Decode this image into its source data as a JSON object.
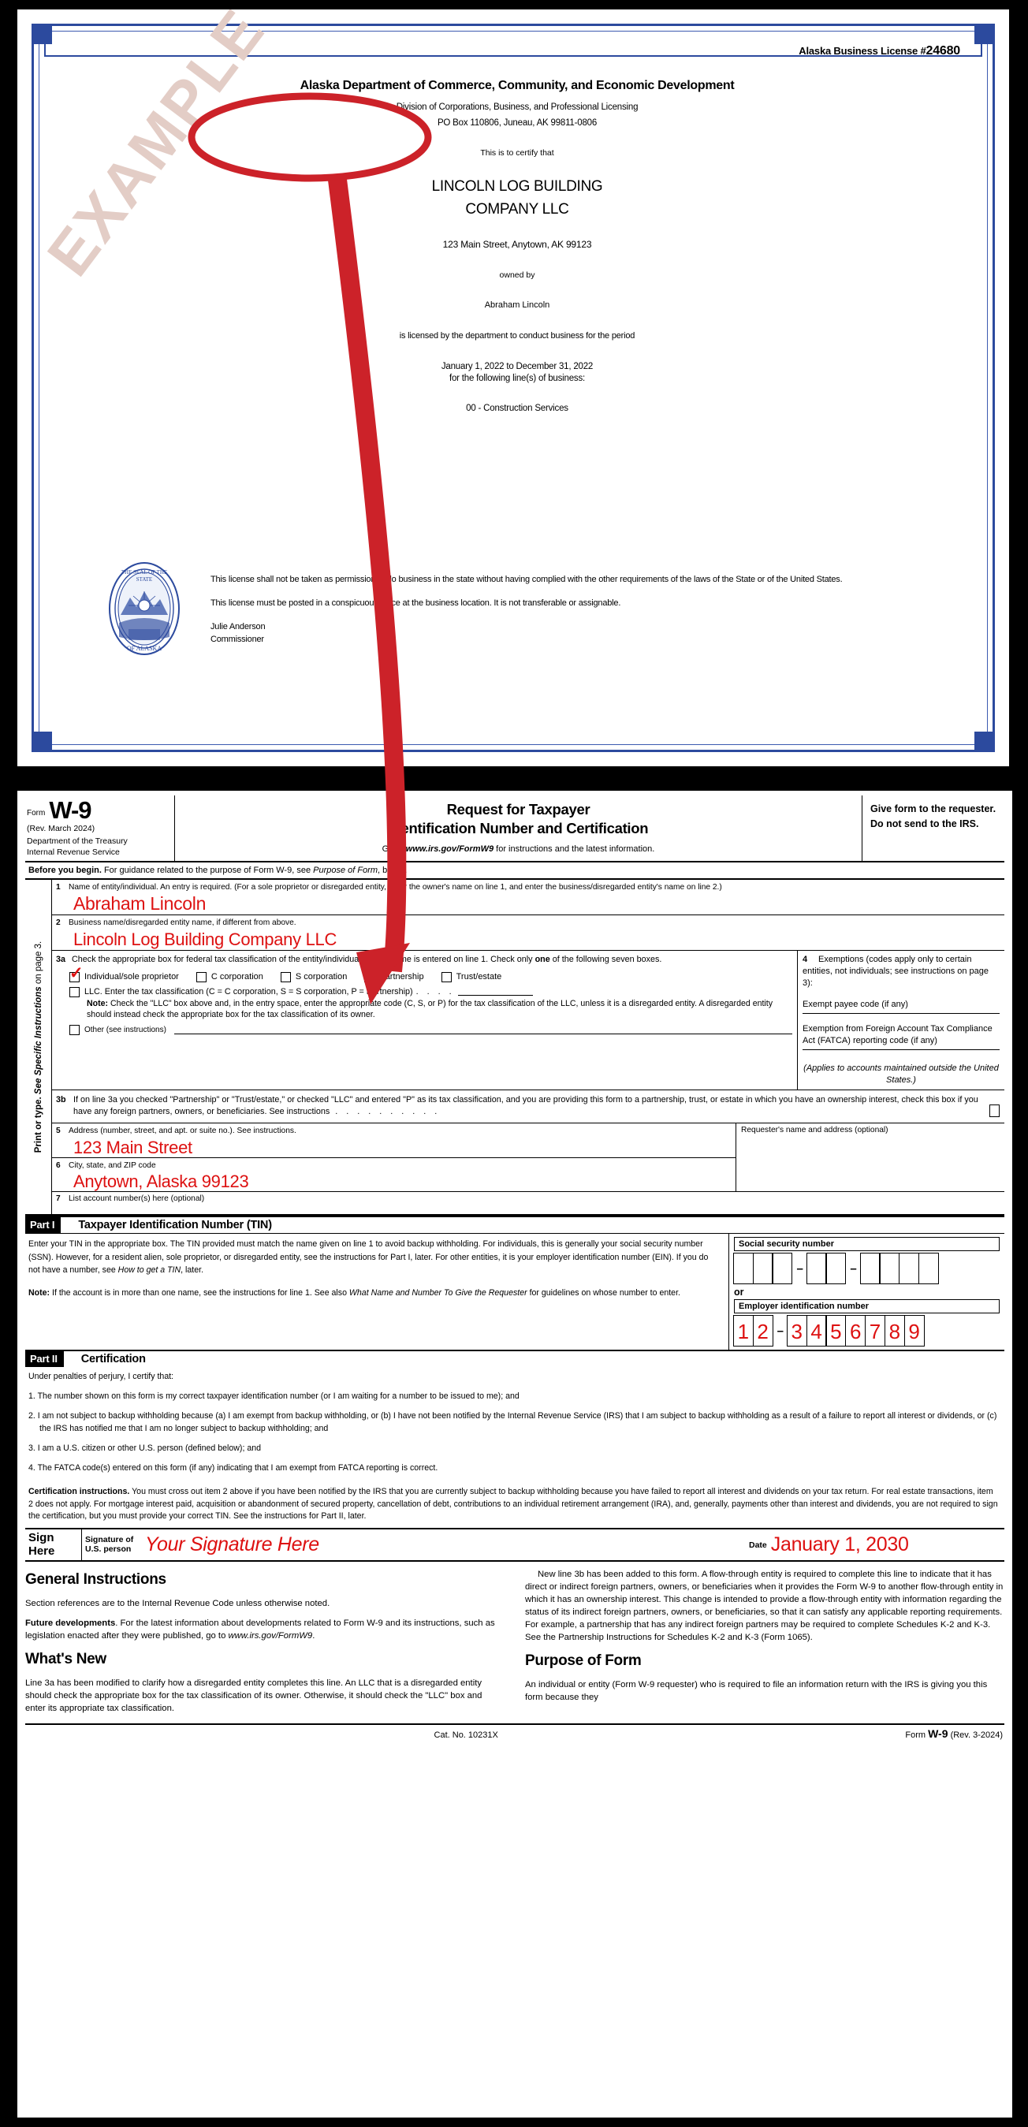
{
  "license": {
    "license_number_label": "Alaska Business License #",
    "license_number": "24680",
    "department": "Alaska Department of Commerce, Community, and Economic Development",
    "division": "Division of Corporations, Business, and Professional Licensing",
    "po_box": "PO Box 110806, Juneau, AK 99811-0806",
    "certify_line": "This is to certify that",
    "business_name_line1": "LINCOLN LOG BUILDING",
    "business_name_line2": "COMPANY LLC",
    "address": "123 Main Street, Anytown, AK 99123",
    "owned_by_label": "owned by",
    "owner_name": "Abraham Lincoln",
    "licensed_line": "is licensed by the department to conduct business for the period",
    "period": "January 1, 2022 to December 31, 2022",
    "lines_of_business_label": "for the following line(s) of business:",
    "line_of_business": "00 - Construction Services",
    "disclaimer_1": "This license shall not be taken as permission to do business in the state without having complied with the other requirements of the laws of the State or of the United States.",
    "disclaimer_2": "This license must be posted in a conspicuous place at the business location. It is not transferable or assignable.",
    "commissioner_name": "Julie Anderson",
    "commissioner_title": "Commissioner",
    "watermark": "EXAMPLE",
    "seal_text_top": "THE SEAL OF THE STATE",
    "seal_text_bottom": "OF ALASKA"
  },
  "w9": {
    "form_word": "Form",
    "form_number": "W-9",
    "revision": "(Rev. March 2024)",
    "department_line1": "Department of the Treasury",
    "department_line2": "Internal Revenue Service",
    "title_line1": "Request for Taxpayer",
    "title_line2": "Identification Number and Certification",
    "goto_prefix": "Go to ",
    "goto_url": "www.irs.gov/FormW9",
    "goto_suffix": " for instructions and the latest information.",
    "give_form_note": "Give form to the requester. Do not send to the IRS.",
    "before_you_begin_bold": "Before you begin.",
    "before_you_begin_text": " For guidance related to the purpose of Form W-9, see ",
    "before_you_begin_italic": "Purpose of Form",
    "before_you_begin_tail": ", below.",
    "side_rail_bold": "Print or type.",
    "side_rail_italic": "See Specific Instructions",
    "side_rail_tail": " on page 3.",
    "line1_num": "1",
    "line1_hint": "Name of entity/individual. An entry is required. (For a sole proprietor or disregarded entity, enter the owner's name on line 1, and enter the business/disregarded entity's name on line 2.)",
    "line1_value": "Abraham Lincoln",
    "line2_num": "2",
    "line2_hint": "Business name/disregarded entity name, if different from above.",
    "line2_value": "Lincoln Log Building Company LLC",
    "line3a_num": "3a",
    "line3a_text_a": "Check the appropriate box for federal tax classification of the entity/individual whose name is entered on line 1. Check only ",
    "line3a_text_bold": "one",
    "line3a_text_b": " of the following seven boxes.",
    "checkbox_individual": "Individual/sole proprietor",
    "checkbox_ccorp": "C corporation",
    "checkbox_scorp": "S corporation",
    "checkbox_partnership": "Partnership",
    "checkbox_trust": "Trust/estate",
    "checked_box": "Individual/sole proprietor",
    "check_mark": "✓",
    "llc_text": "LLC. Enter the tax classification (C = C corporation, S = S corporation, P = Partnership)",
    "llc_note_bold": "Note:",
    "llc_note": " Check the \"LLC\" box above and, in the entry space, enter the appropriate code (C, S, or P) for the tax classification of the LLC, unless it is a disregarded entity. A disregarded entity should instead check the appropriate box for the tax classification of its owner.",
    "other_label": "Other (see instructions)",
    "line3b_num": "3b",
    "line3b_text": "If on line 3a you checked \"Partnership\" or \"Trust/estate,\" or checked \"LLC\" and entered \"P\" as its tax classification, and you are providing this form to a partnership, trust, or estate in which you have an ownership interest, check this box if you have any foreign partners, owners, or beneficiaries. See instructions",
    "line4_num": "4",
    "line4_text": "Exemptions (codes apply only to certain entities, not individuals; see instructions on page 3):",
    "exempt_payee_label": "Exempt payee code (if any)",
    "exempt_payee_value": "",
    "fatca_label": "Exemption from Foreign Account Tax Compliance Act (FATCA) reporting code (if any)",
    "fatca_value": "",
    "applies_note": "(Applies to accounts maintained outside the United States.)",
    "line5_num": "5",
    "line5_hint": "Address (number, street, and apt. or suite no.). See instructions.",
    "line5_value": "123 Main Street",
    "line6_num": "6",
    "line6_hint": "City, state, and ZIP code",
    "line6_value": "Anytown, Alaska 99123",
    "line7_num": "7",
    "line7_hint": "List account number(s) here (optional)",
    "requester_label": "Requester's name and address (optional)",
    "part1_chip": "Part I",
    "part1_title": "Taxpayer Identification Number (TIN)",
    "part1_p1": "Enter your TIN in the appropriate box. The TIN provided must match the name given on line 1 to avoid backup withholding. For individuals, this is generally your social security number (SSN). However, for a resident alien, sole proprietor, or disregarded entity, see the instructions for Part I, later. For other entities, it is your employer identification number (EIN). If you do not have a number, see ",
    "part1_p1_italic": "How to get a TIN",
    "part1_p1_tail": ", later.",
    "part1_note_bold": "Note:",
    "part1_note": " If the account is in more than one name, see the instructions for line 1. See also ",
    "part1_note_italic": "What Name and Number To Give the Requester",
    "part1_note_tail": " for guidelines on whose number to enter.",
    "ssn_label": "Social security number",
    "ssn_digits": [
      "",
      "",
      "",
      "",
      "",
      "",
      "",
      "",
      ""
    ],
    "or_word": "or",
    "ein_label": "Employer identification number",
    "ein_digits": [
      "1",
      "2",
      "3",
      "4",
      "5",
      "6",
      "7",
      "8",
      "9"
    ],
    "part2_chip": "Part II",
    "part2_title": "Certification",
    "cert_intro": "Under penalties of perjury, I certify that:",
    "cert_items": [
      "1. The number shown on this form is my correct taxpayer identification number (or I am waiting for a number to be issued to me); and",
      "2. I am not subject to backup withholding because (a) I am exempt from backup withholding, or (b) I have not been notified by the Internal Revenue Service (IRS) that I am subject to backup withholding as a result of a failure to report all interest or dividends, or (c) the IRS has notified me that I am no longer subject to backup withholding; and",
      "3. I am a U.S. citizen or other U.S. person (defined below); and",
      "4. The FATCA code(s) entered on this form (if any) indicating that I am exempt from FATCA reporting is correct."
    ],
    "cert_instructions_bold": "Certification instructions.",
    "cert_instructions": " You must cross out item 2 above if you have been notified by the IRS that you are currently subject to backup withholding because you have failed to report all interest and dividends on your tax return. For real estate transactions, item 2 does not apply. For mortgage interest paid, acquisition or abandonment of secured property, cancellation of debt, contributions to an individual retirement arrangement (IRA), and, generally, payments other than interest and dividends, you are not required to sign the certification, but you must provide your correct TIN. See the instructions for Part II, later.",
    "sign_here_label": "Sign Here",
    "signature_of_label": "Signature of U.S. person",
    "signature_value": "Your Signature Here",
    "date_label": "Date",
    "date_value": "January 1, 2030",
    "general_instructions_heading": "General Instructions",
    "general_instructions_p1": "Section references are to the Internal Revenue Code unless otherwise noted.",
    "future_dev_bold": "Future developments",
    "future_dev_text": ". For the latest information about developments related to Form W-9 and its instructions, such as legislation enacted after they were published, go to ",
    "future_dev_url": "www.irs.gov/FormW9",
    "future_dev_tail": ".",
    "whats_new_heading": "What's New",
    "whats_new_p1": "Line 3a has been modified to clarify how a disregarded entity completes this line. An LLC that is a disregarded entity should check the appropriate box for the tax classification of its owner. Otherwise, it should check the \"LLC\" box and enter its appropriate tax classification.",
    "whats_new_p2": "New line 3b has been added to this form. A flow-through entity is required to complete this line to indicate that it has direct or indirect foreign partners, owners, or beneficiaries when it provides the Form W-9 to another flow-through entity in which it has an ownership interest. This change is intended to provide a flow-through entity with information regarding the status of its indirect foreign partners, owners, or beneficiaries, so that it can satisfy any applicable reporting requirements. For example, a partnership that has any indirect foreign partners may be required to complete Schedules K-2 and K-3. See the Partnership Instructions for Schedules K-2 and K-3 (Form 1065).",
    "purpose_heading": "Purpose of Form",
    "purpose_p1": "An individual or entity (Form W-9 requester) who is required to file an information return with the IRS is giving you this form because they",
    "cat_no": "Cat. No. 10231X",
    "footer_form_word": "Form",
    "footer_form_number": "W-9",
    "footer_rev": "(Rev. 3-2024)"
  },
  "colors": {
    "license_border_blue": "#2c4a9e",
    "callout_red": "#cc2229",
    "entry_red": "#dd1111",
    "watermark": "#e3cdc6",
    "page_black": "#000000"
  }
}
